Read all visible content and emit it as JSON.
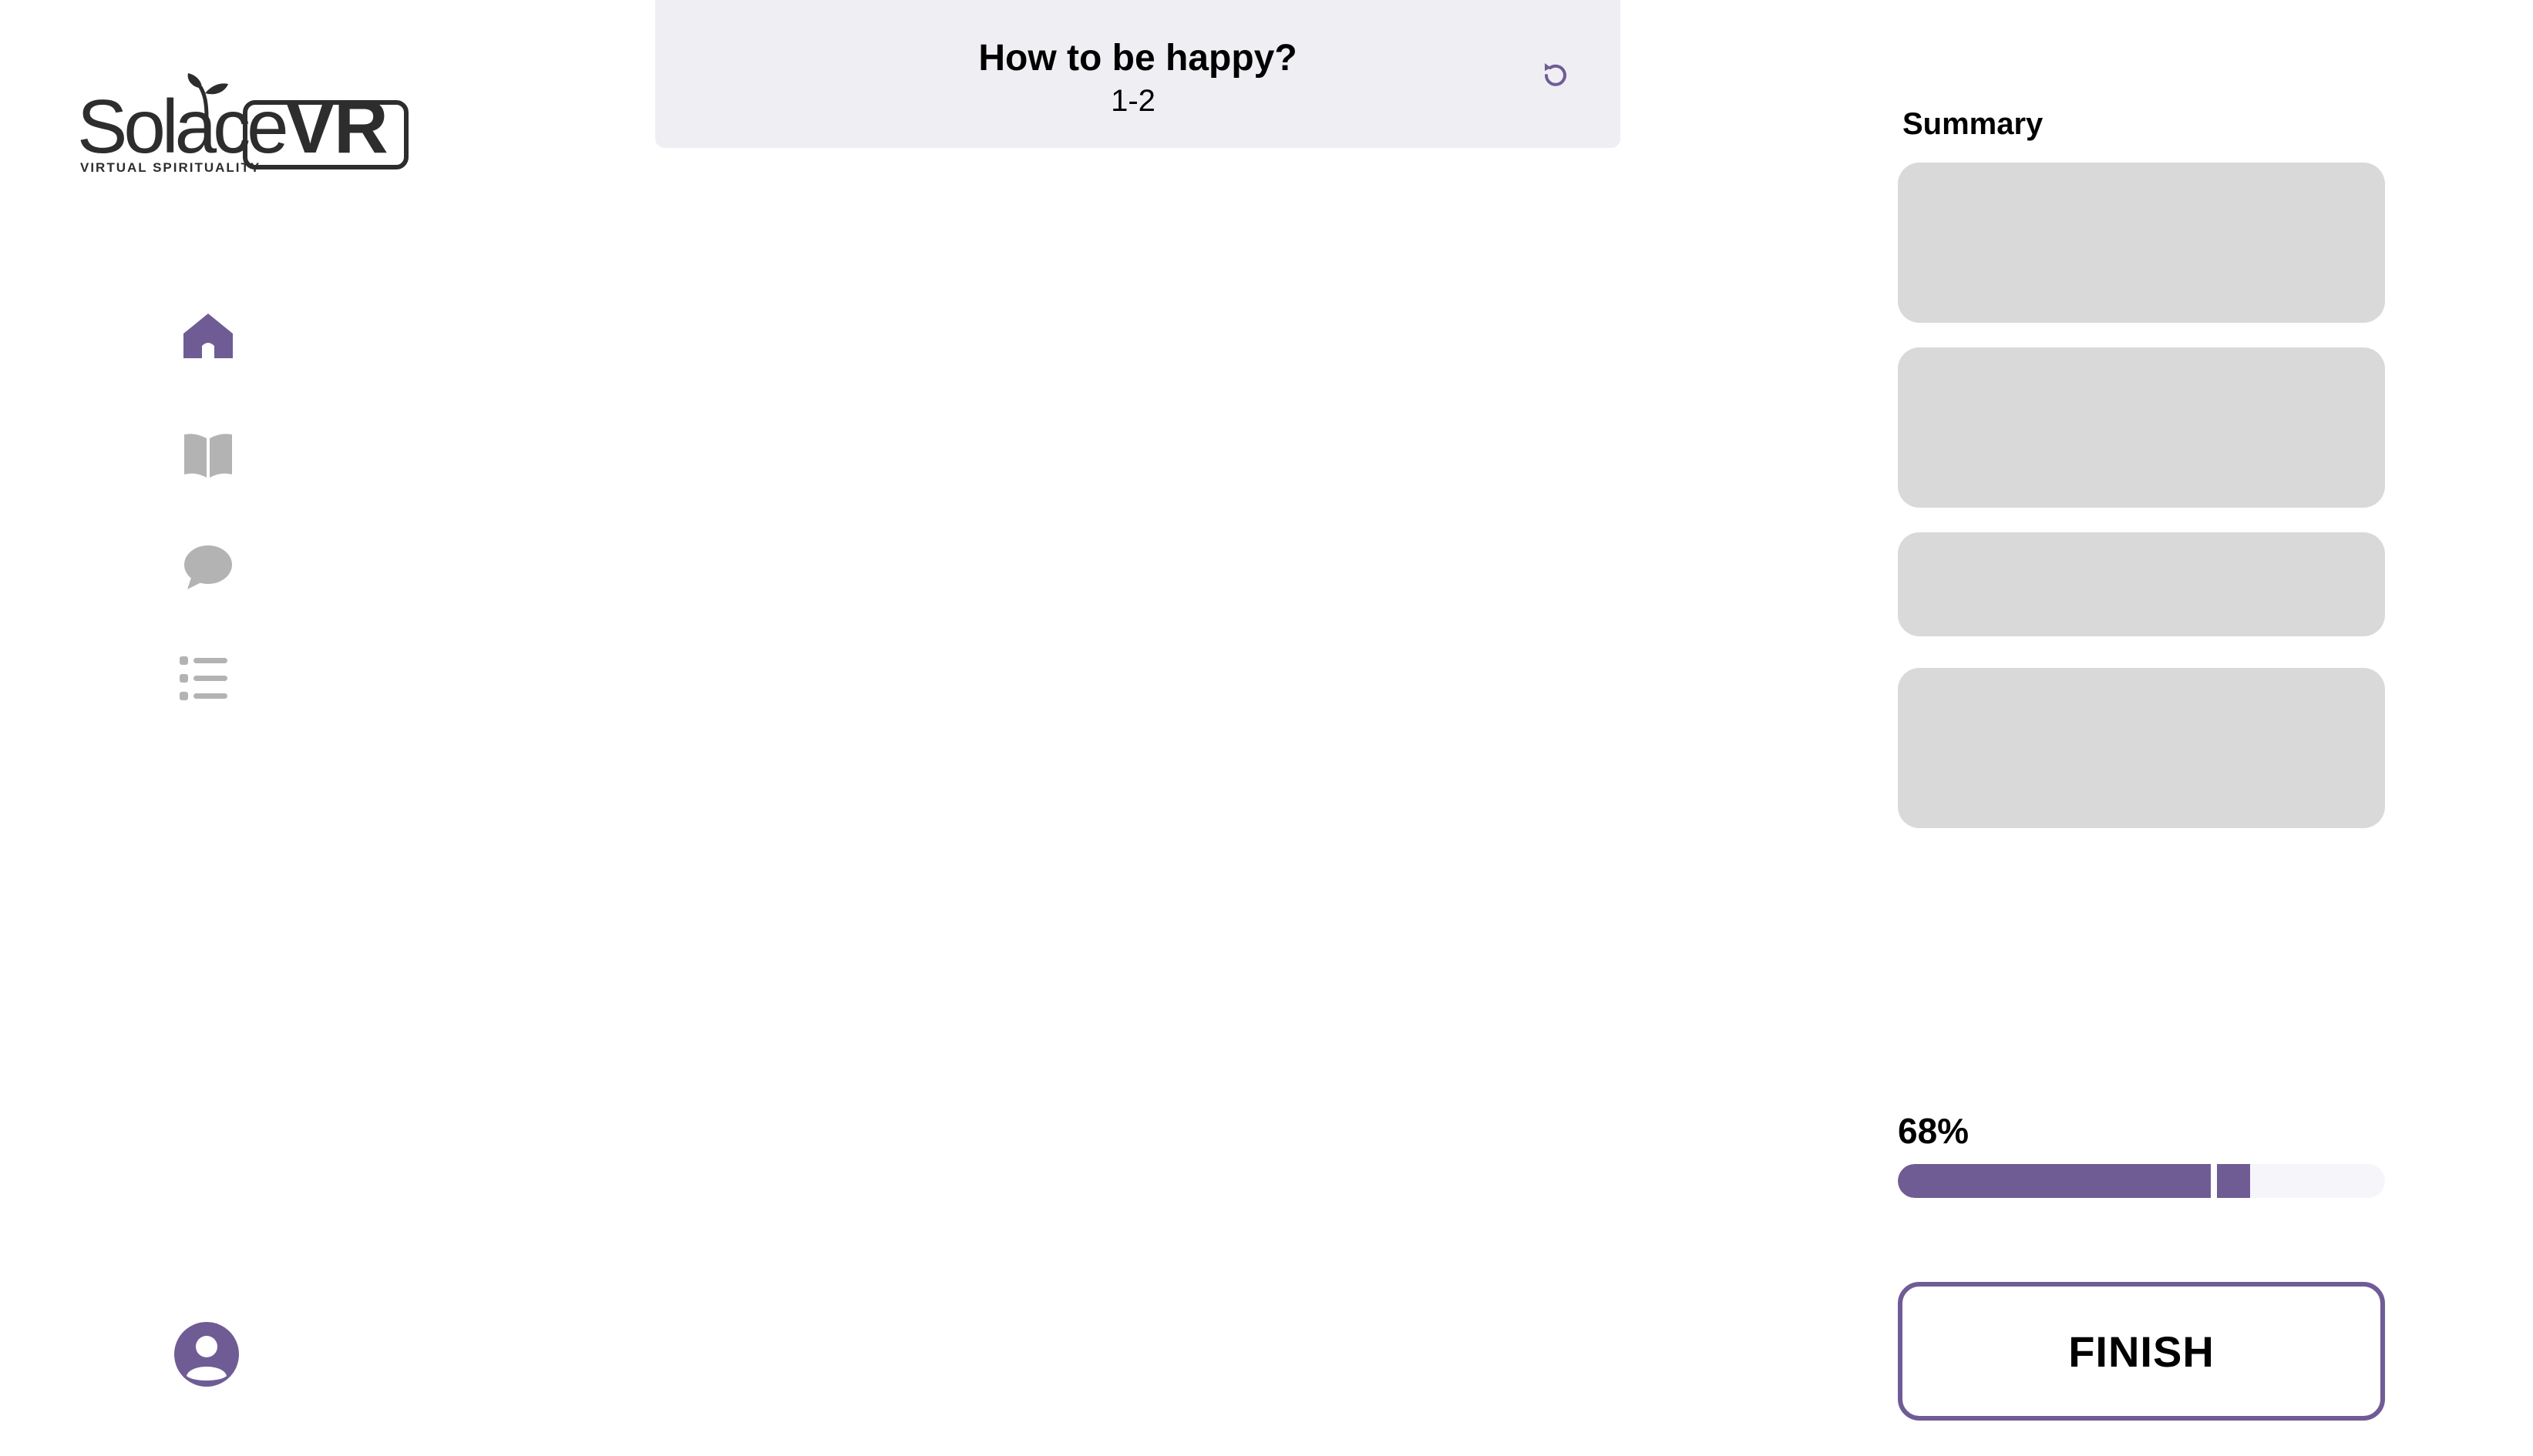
{
  "brand": {
    "name_part1": "Solace",
    "name_part2": "VR",
    "tagline": "VIRTUAL SPIRITUALITY"
  },
  "nav": {
    "items": [
      {
        "icon": "home-icon",
        "active": true
      },
      {
        "icon": "book-icon",
        "active": false
      },
      {
        "icon": "chat-icon",
        "active": false
      },
      {
        "icon": "list-icon",
        "active": false
      }
    ],
    "profile_icon": "user-avatar-icon"
  },
  "header": {
    "title": "How to be happy?",
    "subtitle": "1-2",
    "refresh_icon": "refresh-icon"
  },
  "summary": {
    "label": "Summary",
    "cards": [
      "",
      "",
      "",
      ""
    ]
  },
  "progress": {
    "label": "68%",
    "value_percent": 68
  },
  "finish": {
    "label": "FINISH"
  },
  "colors": {
    "accent": "#6f5c95",
    "inactive_icon": "#b3b3b3",
    "header_bg": "#efeef3",
    "card_bg": "#d9d9d9",
    "track_bg": "#f6f5fa",
    "logo_text": "#2d2d2d"
  }
}
